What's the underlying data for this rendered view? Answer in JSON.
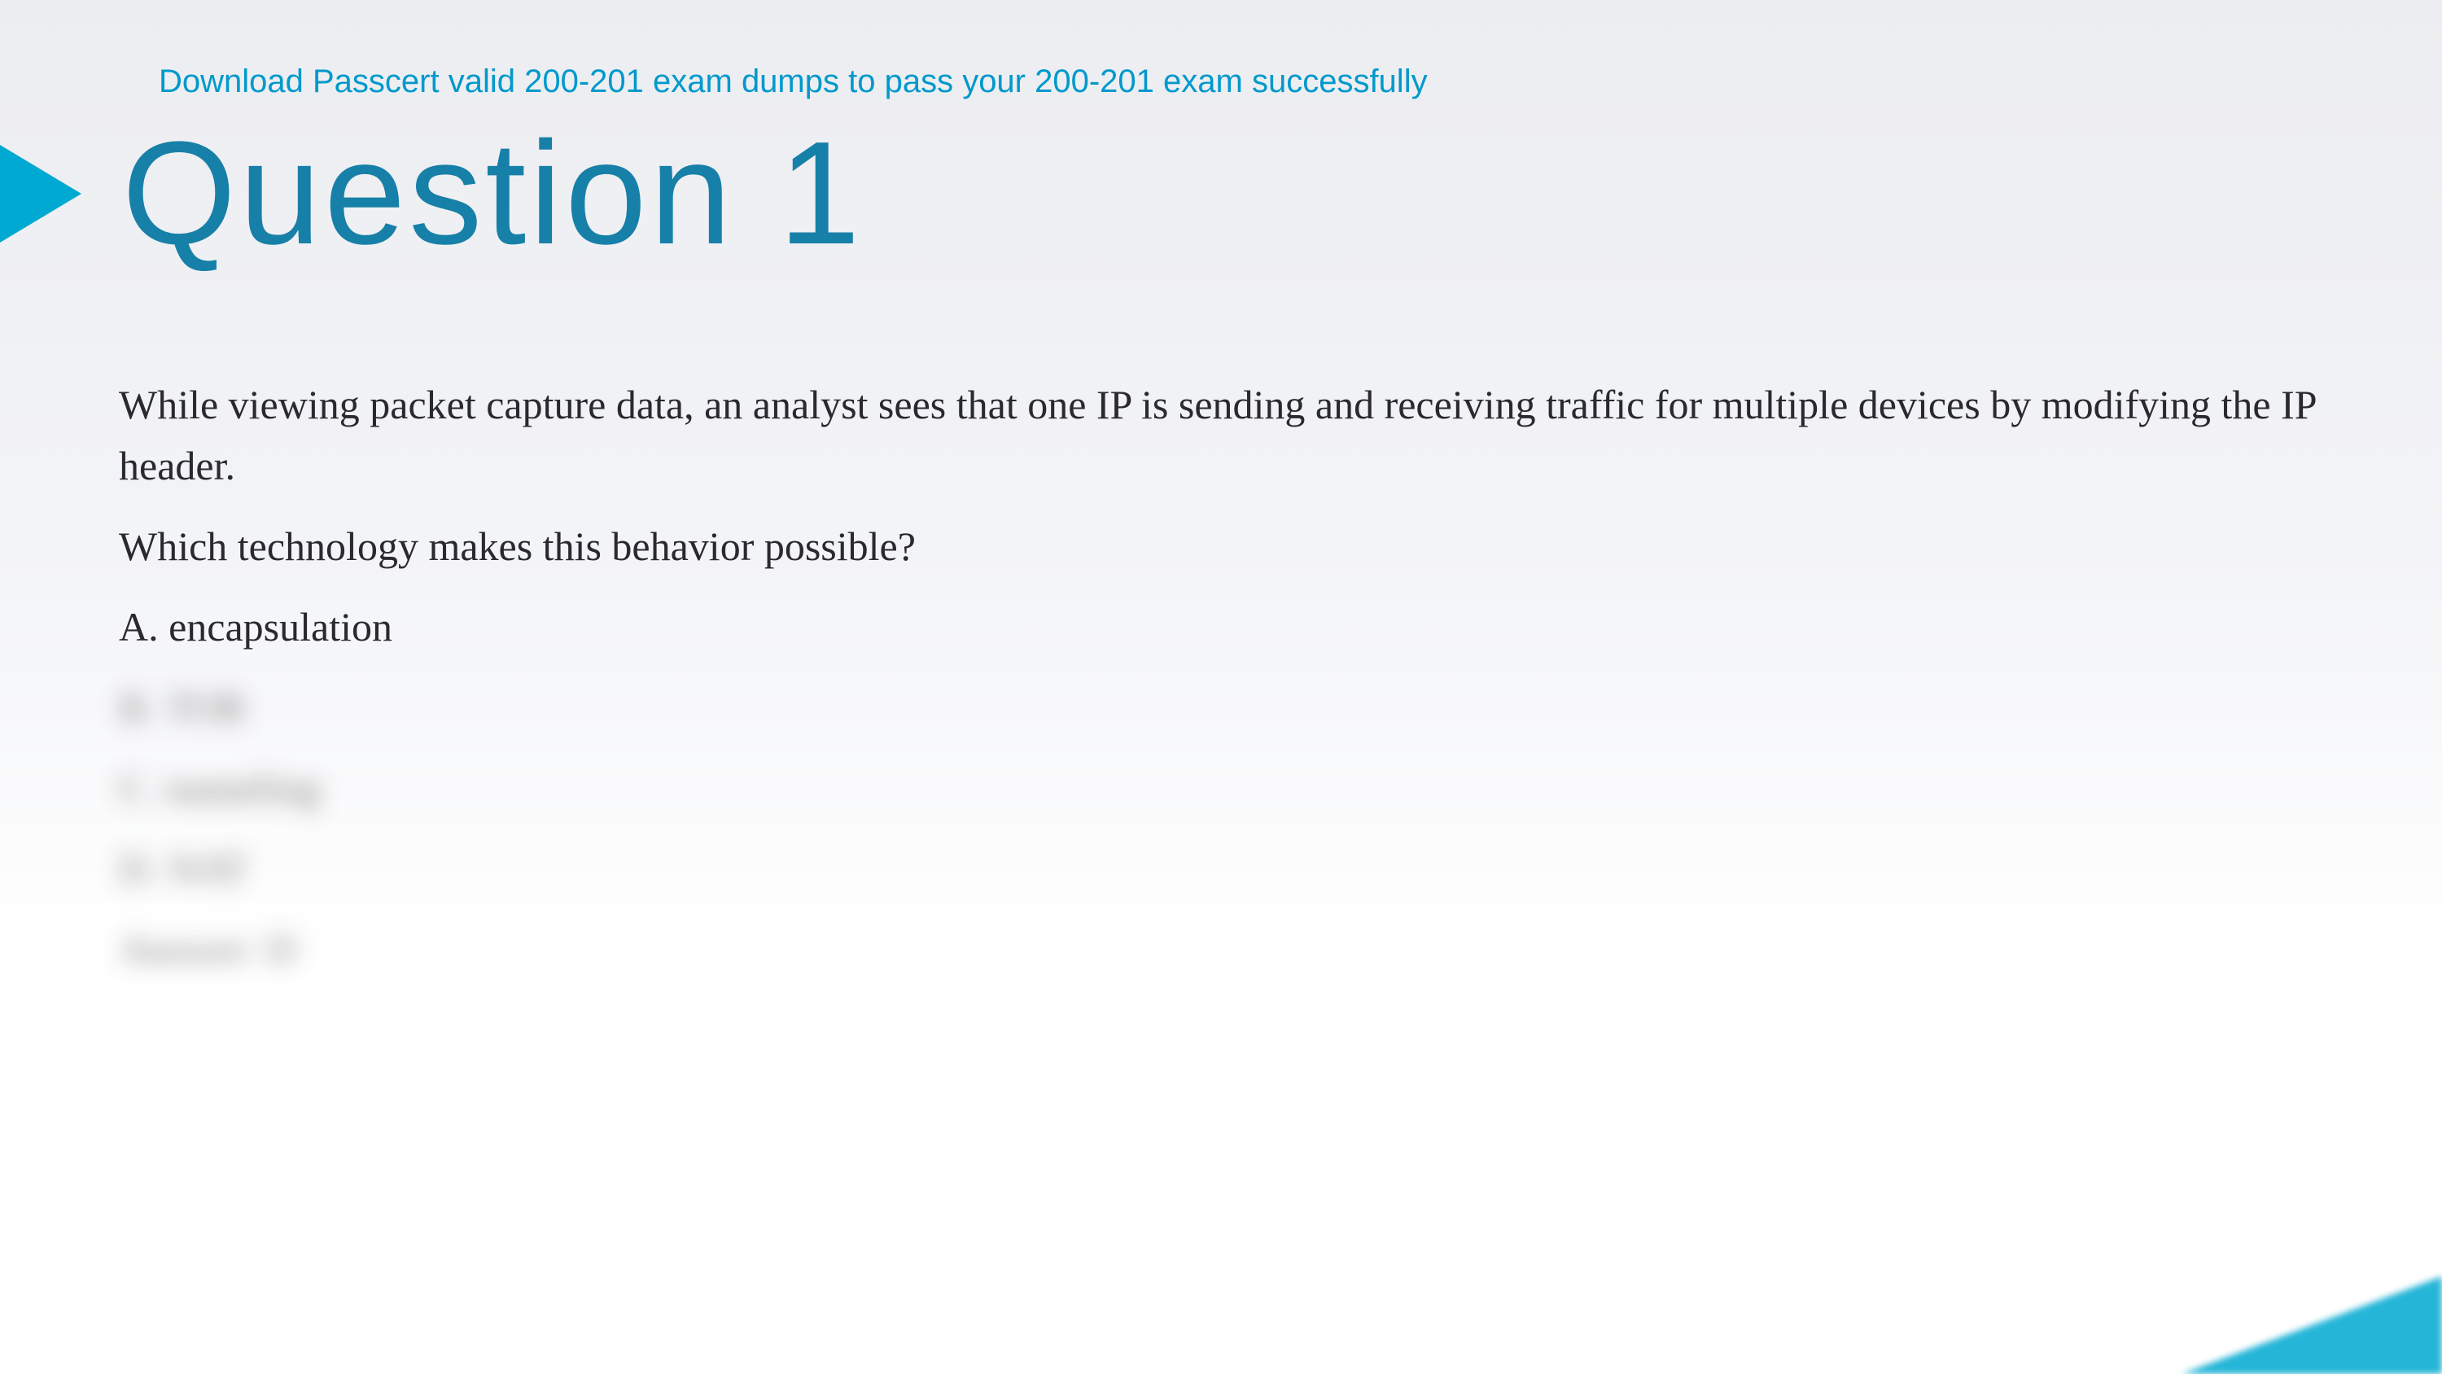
{
  "header": {
    "banner_text": "Download Passcert valid 200-201 exam dumps to pass your 200-201 exam successfully"
  },
  "title": "Question 1",
  "question": {
    "scenario": "While viewing packet capture data, an analyst sees that one IP is sending and receiving traffic for multiple devices by modifying the IP header.",
    "prompt": "Which technology makes this behavior possible?",
    "options": [
      {
        "label": "A. encapsulation",
        "blurred": false
      },
      {
        "label": "B. TOR",
        "blurred": true
      },
      {
        "label": "C. tunneling",
        "blurred": true
      },
      {
        "label": "D. NAT",
        "blurred": true
      }
    ],
    "answer_line": "Answer: D"
  },
  "colors": {
    "accent": "#00a9d1",
    "title": "#1780a8",
    "banner": "#0099cc",
    "body_text": "#29292f"
  }
}
